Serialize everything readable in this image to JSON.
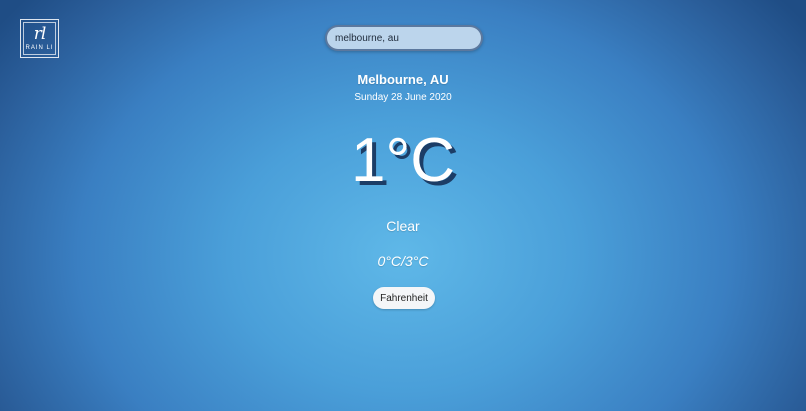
{
  "logo": {
    "mark": "rl",
    "text": "RAIN LI"
  },
  "search": {
    "value": "melbourne, au"
  },
  "weather": {
    "location": "Melbourne, AU",
    "date": "Sunday 28 June 2020",
    "temperature": "1°C",
    "condition": "Clear",
    "range": "0°C/3°C"
  },
  "unit_toggle": {
    "label": "Fahrenheit"
  }
}
